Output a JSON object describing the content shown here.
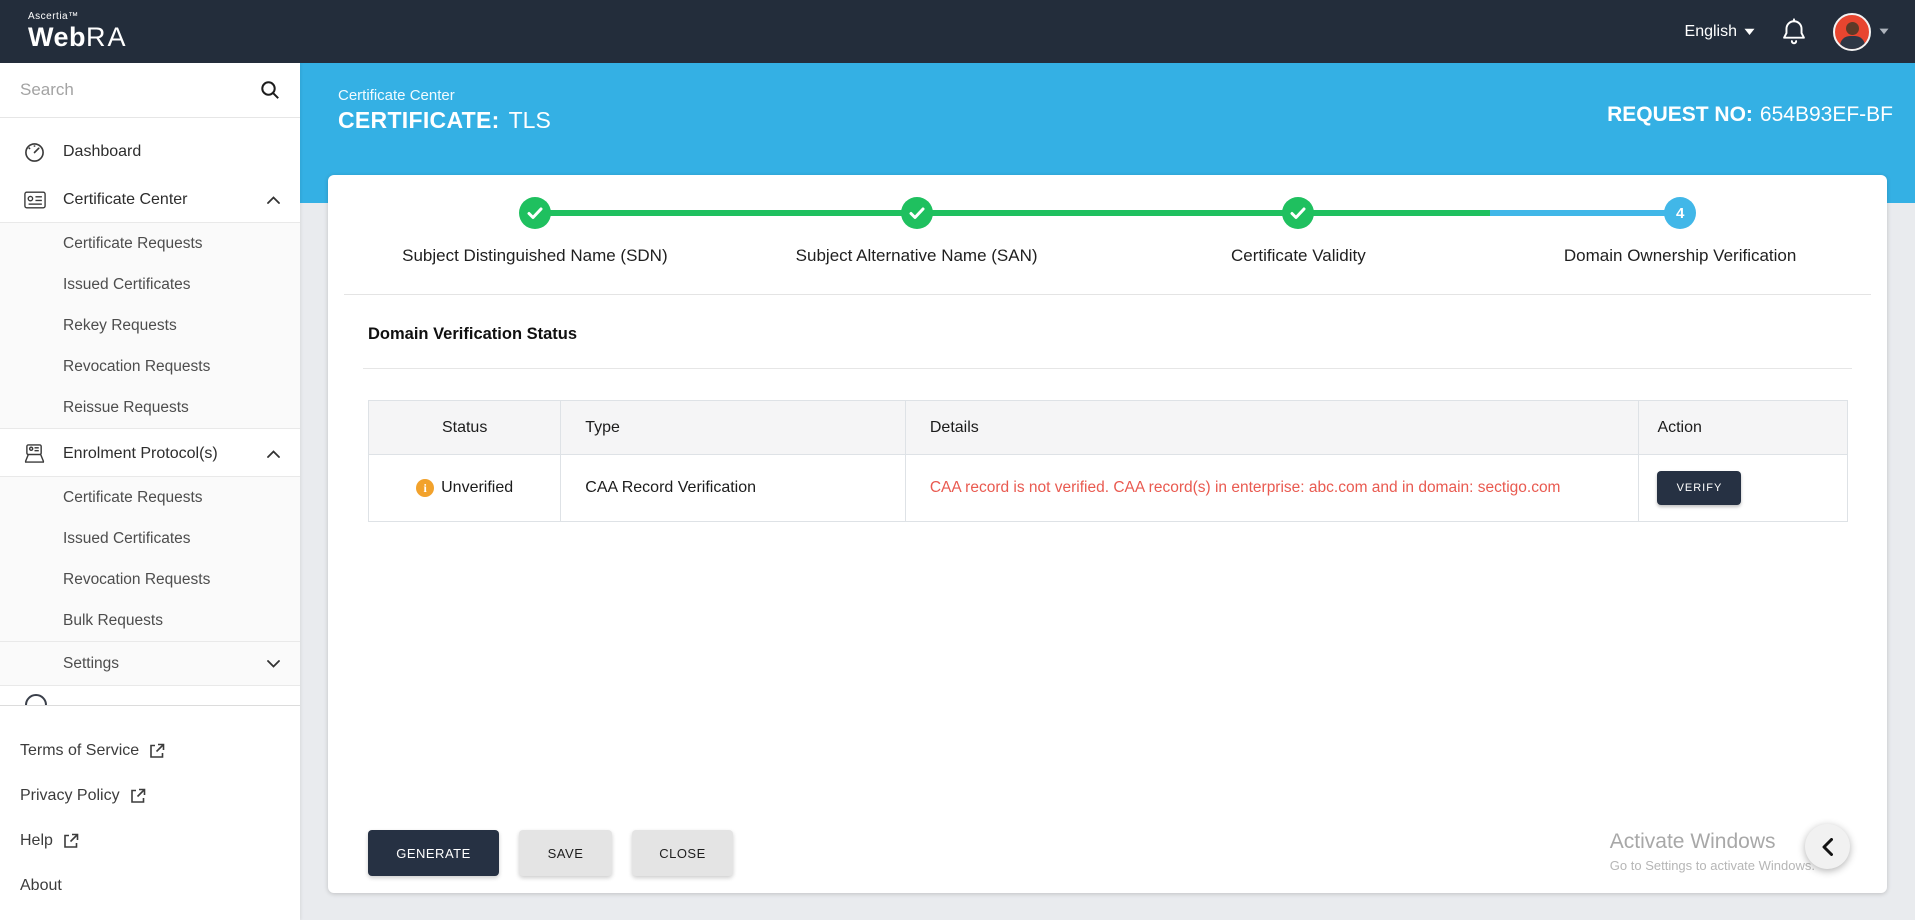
{
  "colors": {
    "navy": "#232d3b",
    "header_blue": "#34b0e4",
    "success_green": "#1fc05f",
    "current_blue": "#41b7e8",
    "warning_amber": "#f2a22c",
    "error_red": "#e95a50",
    "button_dark": "#263143"
  },
  "topbar": {
    "brand_small": "Ascertia™",
    "brand_web": "Web",
    "brand_ra": "RA",
    "language": "English"
  },
  "sidebar": {
    "search_placeholder": "Search",
    "dashboard": "Dashboard",
    "certificate_center": "Certificate Center",
    "cc_items": [
      {
        "label": "Certificate Requests"
      },
      {
        "label": "Issued Certificates"
      },
      {
        "label": "Rekey Requests"
      },
      {
        "label": "Revocation Requests"
      },
      {
        "label": "Reissue Requests"
      }
    ],
    "enrolment": "Enrolment Protocol(s)",
    "ep_items": [
      {
        "label": "Certificate Requests"
      },
      {
        "label": "Issued Certificates"
      },
      {
        "label": "Revocation Requests"
      },
      {
        "label": "Bulk Requests"
      }
    ],
    "settings": "Settings",
    "footer_links": [
      {
        "label": "Terms of Service"
      },
      {
        "label": "Privacy Policy"
      },
      {
        "label": "Help"
      },
      {
        "label": "About"
      }
    ]
  },
  "header": {
    "breadcrumb": "Certificate Center",
    "title_label": "CERTIFICATE:",
    "title_value": "TLS",
    "request_label": "REQUEST NO:",
    "request_value": "654B93EF-BF"
  },
  "stepper": {
    "steps": [
      {
        "label": "Subject Distinguished Name (SDN)",
        "state": "done"
      },
      {
        "label": "Subject Alternative Name (SAN)",
        "state": "done"
      },
      {
        "label": "Certificate Validity",
        "state": "done"
      },
      {
        "label": "Domain Ownership Verification",
        "state": "current",
        "number": "4"
      }
    ]
  },
  "section": {
    "heading": "Domain Verification Status"
  },
  "table": {
    "columns": [
      "Status",
      "Type",
      "Details",
      "Action"
    ],
    "rows": [
      {
        "status": "Unverified",
        "type": "CAA Record Verification",
        "details": "CAA record is not verified. CAA record(s) in enterprise: abc.com and in domain: sectigo.com",
        "action": "VERIFY"
      }
    ]
  },
  "footer_buttons": {
    "generate": "GENERATE",
    "save": "SAVE",
    "close": "CLOSE"
  },
  "watermark": {
    "line1": "Activate Windows",
    "line2": "Go to Settings to activate Windows."
  }
}
